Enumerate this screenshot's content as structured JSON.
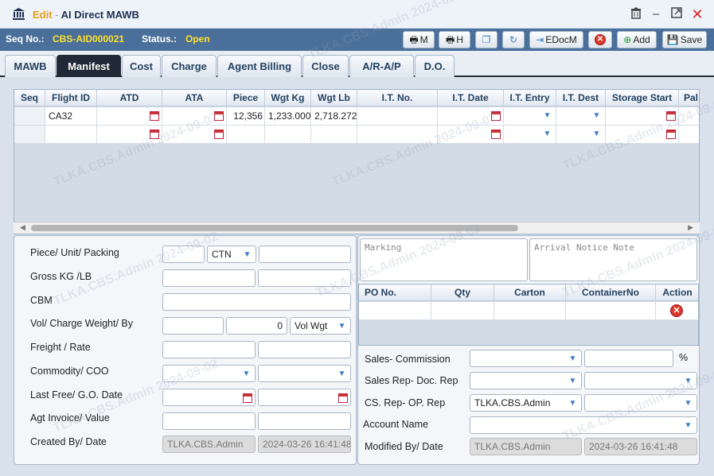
{
  "window": {
    "mode": "Edit",
    "dash": "-",
    "title": "AI Direct MAWB"
  },
  "seqbar": {
    "seq_label": "Seq No.:",
    "seq_value": "CBS-AID000021",
    "status_label": "Status.:",
    "status_value": "Open"
  },
  "toolbar": {
    "print_m": "M",
    "print_h": "H",
    "edocm": "EDocM",
    "add": "Add",
    "save": "Save"
  },
  "tabs": [
    "MAWB",
    "Manifest",
    "Cost",
    "Charge",
    "Agent Billing",
    "Close",
    "A/R-A/P",
    "D.O."
  ],
  "grid": {
    "headers": [
      "Seq",
      "Flight ID",
      "ATD",
      "ATA",
      "Piece",
      "Wgt Kg",
      "Wgt Lb",
      "I.T. No.",
      "I.T. Date",
      "I.T. Entry",
      "I.T. Dest",
      "Storage Start",
      "Pal"
    ],
    "rows": [
      {
        "flight": "CA32",
        "piece": "12,356",
        "wgt_kg": "1,233.000",
        "wgt_lb": "2,718.272"
      },
      {
        "flight": "",
        "piece": "",
        "wgt_kg": "",
        "wgt_lb": ""
      }
    ]
  },
  "left_form": {
    "piece_label": "Piece/ Unit/ Packing",
    "unit_value": "CTN",
    "gross_label": "Gross KG  /LB",
    "cbm_label": "CBM",
    "vol_label": "Vol/ Charge Weight/ By",
    "charge_weight": "0",
    "by_value": "Vol Wgt",
    "freight_label": "Freight / Rate",
    "commodity_label": "Commodity/ COO",
    "lastfree_label": "Last Free/  G.O. Date",
    "invoice_label": "Agt Invoice/ Value",
    "created_label": "Created By/ Date",
    "created_by": "TLKA.CBS.Admin",
    "created_date": "2024-03-26 16:41:48"
  },
  "right_form": {
    "marking_placeholder": "Marking",
    "arrival_placeholder": "Arrival Notice Note",
    "po_headers": [
      "PO No.",
      "Qty",
      "Carton",
      "ContainerNo",
      "Action"
    ],
    "sales_label": "Sales- Commission",
    "percent": "%",
    "salesrep_label": "Sales Rep- Doc. Rep",
    "csrep_label": "CS. Rep- OP. Rep",
    "cs_value": "TLKA.CBS.Admin",
    "account_label": "Account Name",
    "modified_label": "Modified By/ Date",
    "modified_by": "TLKA.CBS.Admin",
    "modified_date": "2024-03-26 16:41:48"
  },
  "watermark": "TLKA.CBS.Admin 2024-09-02"
}
